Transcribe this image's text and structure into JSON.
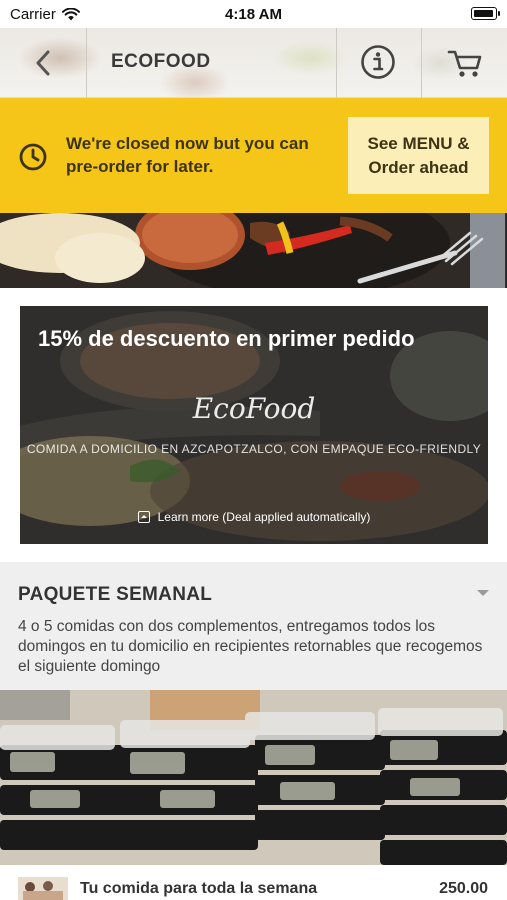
{
  "status_bar": {
    "carrier": "Carrier",
    "time": "4:18 AM"
  },
  "nav": {
    "title": "ECOFOOD",
    "icons": [
      "chevron-left-icon",
      "info-icon",
      "cart-icon"
    ]
  },
  "closed_banner": {
    "message": "We're closed now but you can pre-order for later.",
    "button_label": "See MENU & Order ahead",
    "background_color": "#f5c518",
    "icon": "clock-icon"
  },
  "promo": {
    "title": "15% de descuento en primer pedido",
    "logo_text": "EcoFood",
    "subtitle": "COMIDA A DOMICILIO EN AZCAPOTZALCO, CON EMPAQUE ECO-FRIENDLY",
    "link_label": "Learn more (Deal applied automatically)"
  },
  "section": {
    "title": "PAQUETE SEMANAL",
    "description": "4 o 5 comidas con dos complementos, entregamos todos los domingos en tu domicilio en recipientes retornables que recogemos el siguiente domingo"
  },
  "product": {
    "name": "Tu comida para toda la semana",
    "price": "250.00"
  }
}
